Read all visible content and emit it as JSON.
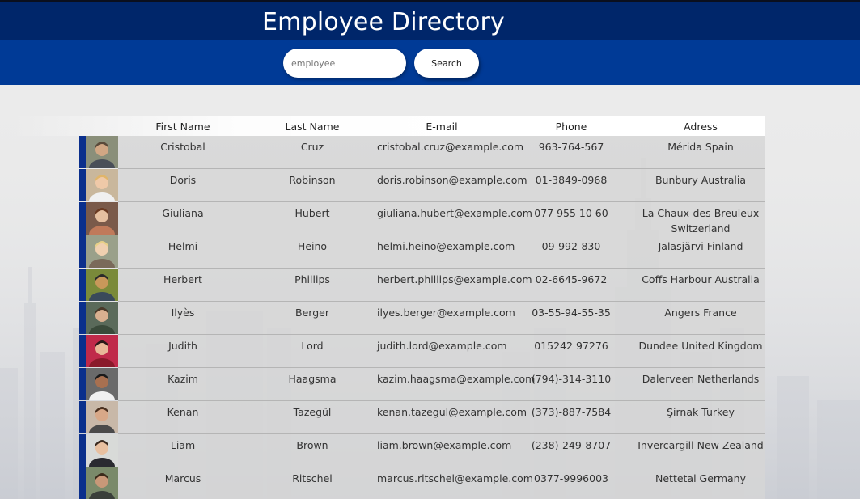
{
  "header": {
    "title": "Employee Directory"
  },
  "search": {
    "placeholder": "employee",
    "button_label": "Search"
  },
  "table": {
    "columns": [
      "First Name",
      "Last Name",
      "E-mail",
      "Phone",
      "Adress"
    ],
    "rows": [
      {
        "first": "Cristobal",
        "last": "Cruz",
        "email": "cristobal.cruz@example.com",
        "phone": "963-764-567",
        "address": "Mérida Spain"
      },
      {
        "first": "Doris",
        "last": "Robinson",
        "email": "doris.robinson@example.com",
        "phone": "01-3849-0968",
        "address": "Bunbury Australia"
      },
      {
        "first": "Giuliana",
        "last": "Hubert",
        "email": "giuliana.hubert@example.com",
        "phone": "077 955 10 60",
        "address": "La Chaux-des-Breuleux Switzerland"
      },
      {
        "first": "Helmi",
        "last": "Heino",
        "email": "helmi.heino@example.com",
        "phone": "09-992-830",
        "address": "Jalasjärvi Finland"
      },
      {
        "first": "Herbert",
        "last": "Phillips",
        "email": "herbert.phillips@example.com",
        "phone": "02-6645-9672",
        "address": "Coffs Harbour Australia"
      },
      {
        "first": "Ilyès",
        "last": "Berger",
        "email": "ilyes.berger@example.com",
        "phone": "03-55-94-55-35",
        "address": "Angers France"
      },
      {
        "first": "Judith",
        "last": "Lord",
        "email": "judith.lord@example.com",
        "phone": "015242 97276",
        "address": "Dundee United Kingdom"
      },
      {
        "first": "Kazim",
        "last": "Haagsma",
        "email": "kazim.haagsma@example.com",
        "phone": "(794)-314-3110",
        "address": "Dalerveen Netherlands"
      },
      {
        "first": "Kenan",
        "last": "Tazegül",
        "email": "kenan.tazegul@example.com",
        "phone": "(373)-887-7584",
        "address": "Şirnak Turkey"
      },
      {
        "first": "Liam",
        "last": "Brown",
        "email": "liam.brown@example.com",
        "phone": "(238)-249-8707",
        "address": "Invercargill New Zealand"
      },
      {
        "first": "Marcus",
        "last": "Ritschel",
        "email": "marcus.ritschel@example.com",
        "phone": "0377-9996003",
        "address": "Nettetal Germany"
      }
    ]
  },
  "colors": {
    "header_top": "#00266a",
    "header_bar": "#003a96",
    "row_accent": "#0a2f8c",
    "row_background": "#d6d6d6"
  }
}
